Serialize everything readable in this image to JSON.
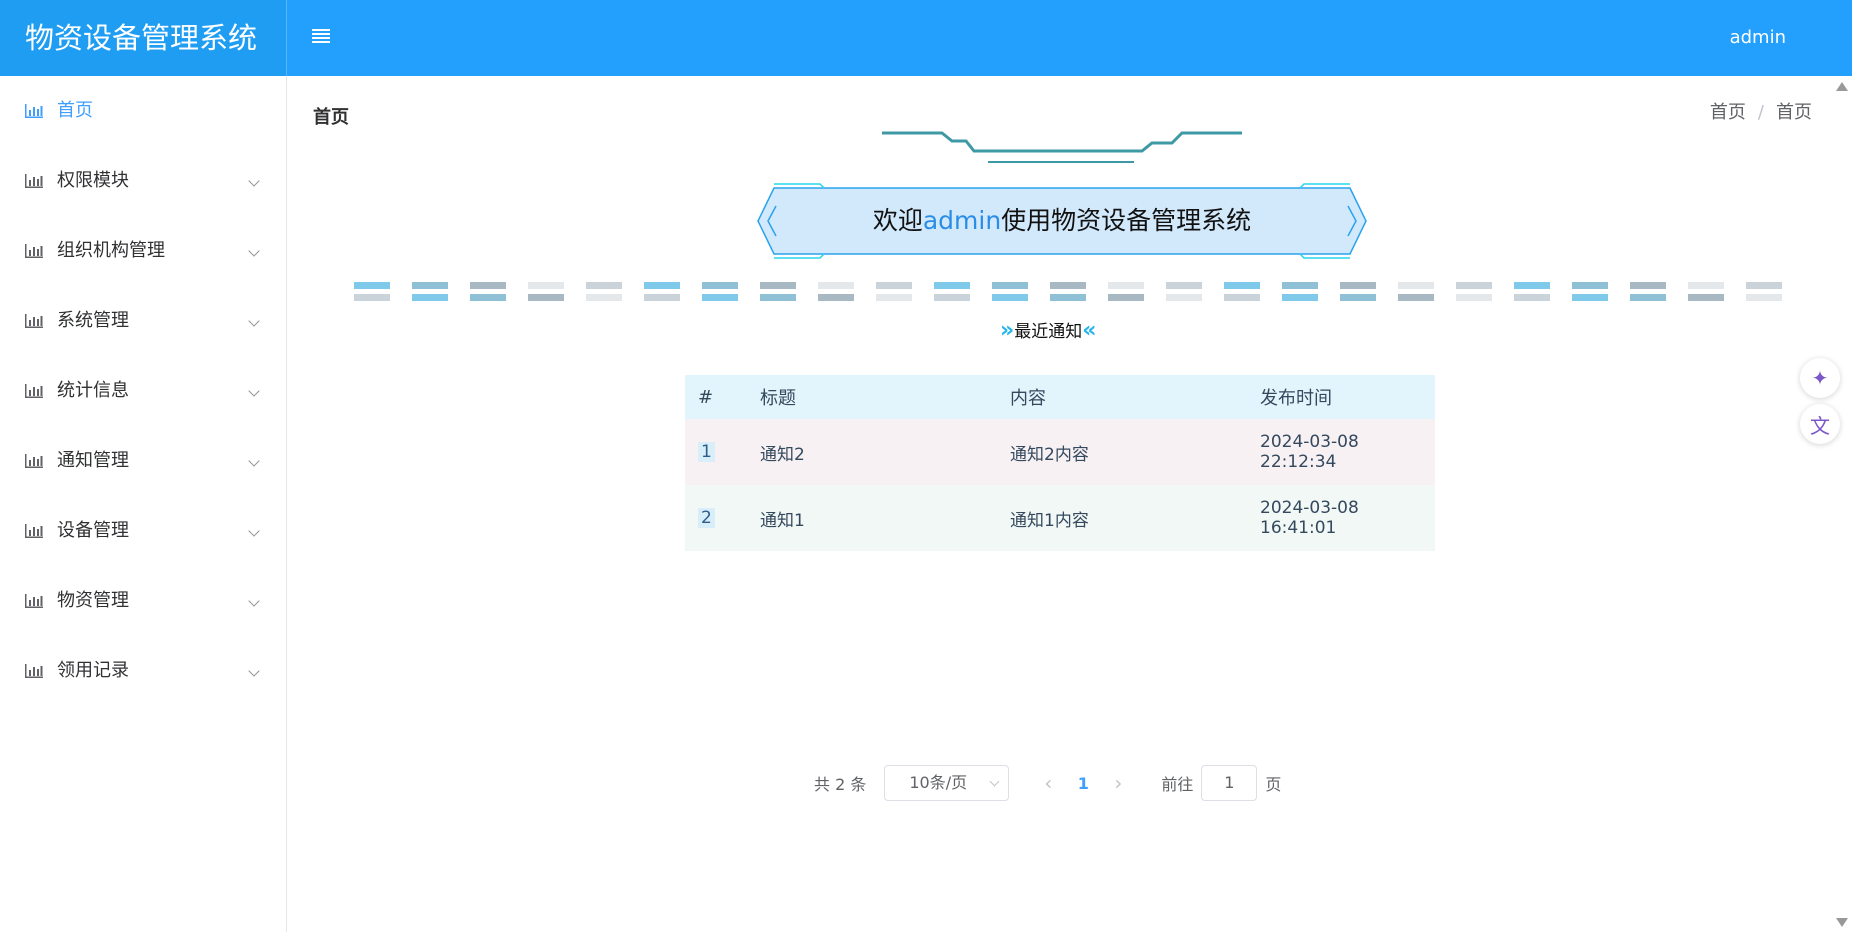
{
  "app": {
    "title": "物资设备管理系统"
  },
  "header": {
    "user": "admin",
    "menu_icon": "hamburger-icon"
  },
  "sidebar": {
    "items": [
      {
        "label": "首页",
        "active": true
      },
      {
        "label": "权限模块"
      },
      {
        "label": "组织机构管理"
      },
      {
        "label": "系统管理"
      },
      {
        "label": "统计信息"
      },
      {
        "label": "通知管理"
      },
      {
        "label": "设备管理"
      },
      {
        "label": "物资管理"
      },
      {
        "label": "领用记录"
      }
    ]
  },
  "page": {
    "title": "首页",
    "breadcrumb": [
      "首页",
      "首页"
    ],
    "welcome_prefix": "欢迎",
    "welcome_user": "admin",
    "welcome_suffix": "使用物资设备管理系统",
    "notice_title": "最近通知"
  },
  "table": {
    "headers": [
      "#",
      "标题",
      "内容",
      "发布时间"
    ],
    "rows": [
      {
        "index": "1",
        "title": "通知2",
        "content": "通知2内容",
        "time": "2024-03-08 22:12:34"
      },
      {
        "index": "2",
        "title": "通知1",
        "content": "通知1内容",
        "time": "2024-03-08 16:41:01"
      }
    ]
  },
  "pagination": {
    "total": "共 2 条",
    "page_size": "10条/页",
    "current_page": "1",
    "goto_prefix": "前往",
    "goto_value": "1",
    "goto_suffix": "页"
  },
  "colors": {
    "header": "#23a0fd",
    "active": "#409eff",
    "table_head": "#e3f5fc"
  }
}
